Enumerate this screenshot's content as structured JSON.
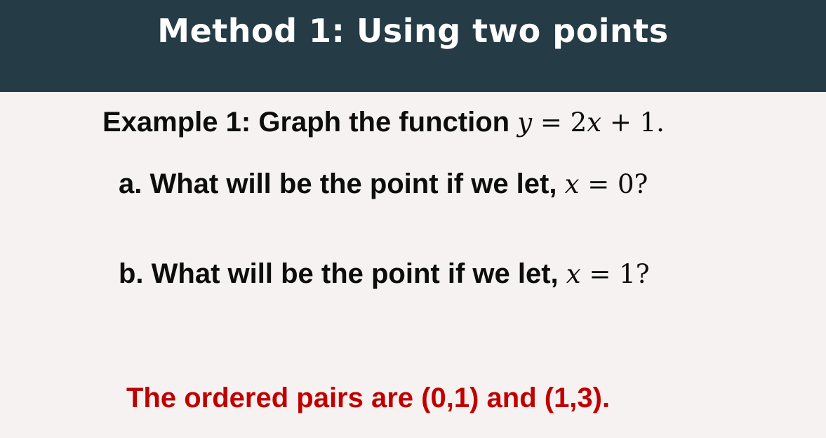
{
  "title": "Method 1: Using two points",
  "example": {
    "text": "Example 1: Graph the function ",
    "math": {
      "lhs": "y",
      "op1": " = 2",
      "var": "x",
      "rest": " + 1."
    }
  },
  "questions": [
    {
      "text": "a. What will be the point if we let, ",
      "math_var": "x",
      "math_rest": " = 0?"
    },
    {
      "text": "b. What will be the point if we let, ",
      "math_var": "x",
      "math_rest": " = 1?"
    }
  ],
  "answer": "The ordered pairs are (0,1) and (1,3).",
  "colors": {
    "title_bar": "#253b45",
    "background": "#f6f2f1",
    "answer_text": "#c00000"
  }
}
